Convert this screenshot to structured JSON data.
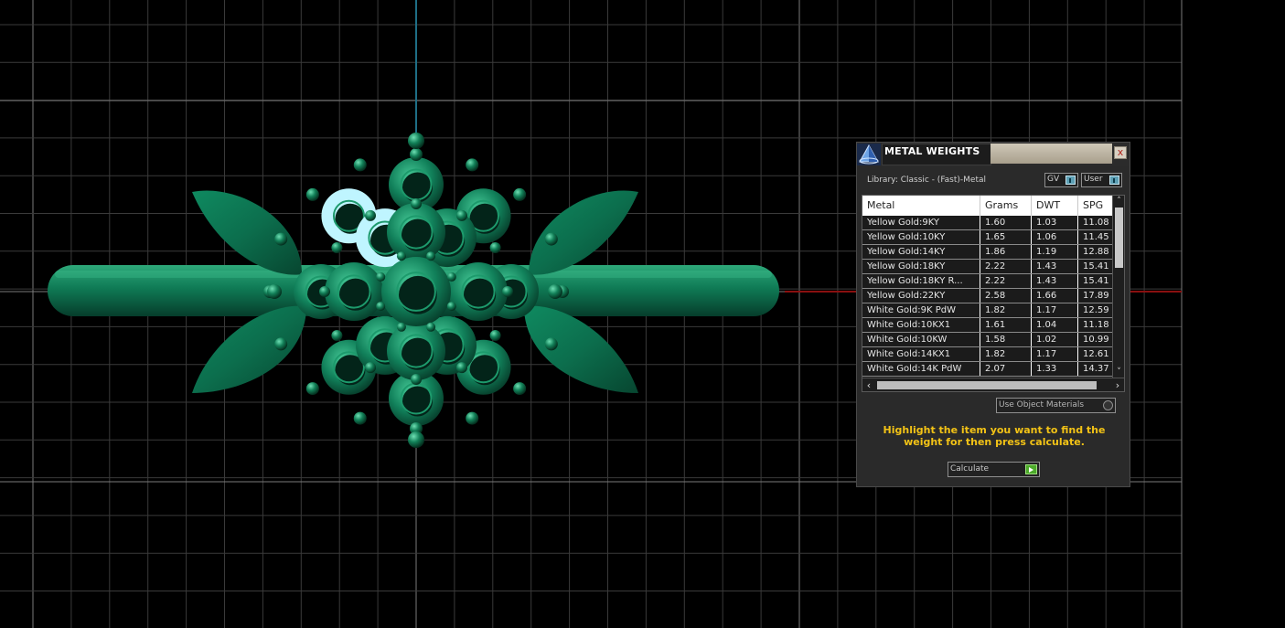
{
  "panel": {
    "title": "METAL WEIGHTS",
    "close_label": "x",
    "library_label": "Library: Classic - (Fast)-Metal",
    "toggle_gv": "GV",
    "toggle_user": "User",
    "table": {
      "columns": [
        "Metal",
        "Grams",
        "DWT",
        "SPG"
      ],
      "rows": [
        [
          "Yellow Gold:9KY",
          "1.60",
          "1.03",
          "11.08"
        ],
        [
          "Yellow Gold:10KY",
          "1.65",
          "1.06",
          "11.45"
        ],
        [
          "Yellow Gold:14KY",
          "1.86",
          "1.19",
          "12.88"
        ],
        [
          "Yellow Gold:18KY",
          "2.22",
          "1.43",
          "15.41"
        ],
        [
          "Yellow Gold:18KY R...",
          "2.22",
          "1.43",
          "15.41"
        ],
        [
          "Yellow Gold:22KY",
          "2.58",
          "1.66",
          "17.89"
        ],
        [
          "White Gold:9K PdW",
          "1.82",
          "1.17",
          "12.59"
        ],
        [
          "White Gold:10KX1",
          "1.61",
          "1.04",
          "11.18"
        ],
        [
          "White Gold:10KW",
          "1.58",
          "1.02",
          "10.99"
        ],
        [
          "White Gold:14KX1",
          "1.82",
          "1.17",
          "12.61"
        ],
        [
          "White Gold:14K PdW",
          "2.07",
          "1.33",
          "14.37"
        ]
      ]
    },
    "use_object_materials_label": "Use Object Materials",
    "instructions": "Highlight the item you want to find the weight for then press calculate.",
    "calculate_label": "Calculate"
  },
  "colors": {
    "background": "#000000",
    "grid": "#3c3c3c",
    "y_axis": "#1f6f86",
    "x_axis": "#8a1010",
    "model_green": "#0d7a55",
    "instruction_text": "#f3c316",
    "calculate_arrow": "#4caa2a"
  },
  "icons": {
    "panel_logo": "pyramid-logo-icon",
    "close": "close-icon",
    "calculate": "play-arrow-icon",
    "scroll_up": "chevron-up-icon",
    "scroll_down": "chevron-down-icon",
    "scroll_left": "chevron-left-icon",
    "scroll_right": "chevron-right-icon"
  }
}
